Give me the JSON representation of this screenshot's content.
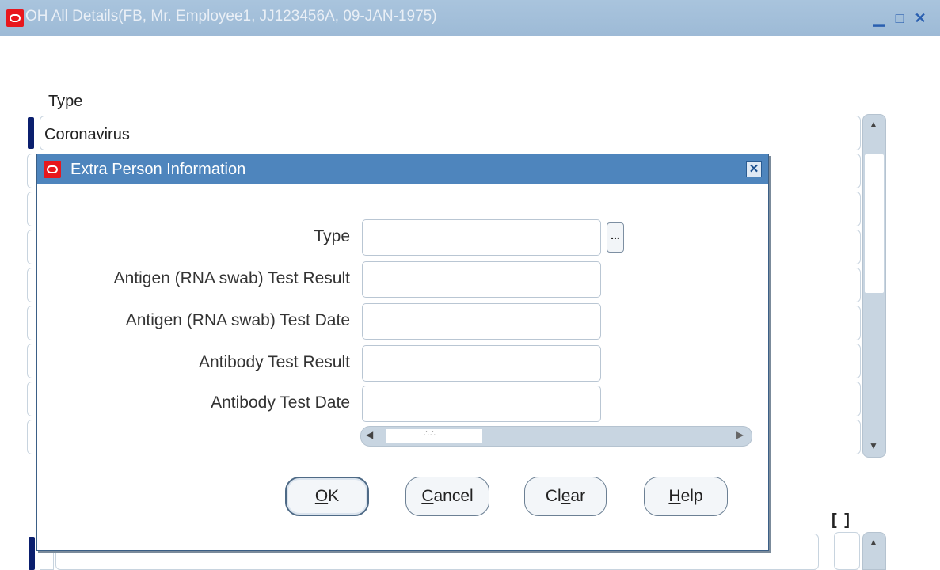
{
  "window": {
    "title": "OH All Details(FB, Mr. Employee1, JJ123456A, 09-JAN-1975)",
    "minimize_icon": "minimize-icon",
    "maximize_icon": "maximize-icon",
    "close_icon": "close-icon"
  },
  "form": {
    "type_header": "Type",
    "rows": [
      "Coronavirus",
      "",
      "",
      "",
      "",
      "",
      "",
      "",
      ""
    ],
    "bracket_label": "[ ]"
  },
  "dialog": {
    "title": "Extra Person Information",
    "fields": [
      {
        "label": "Type",
        "value": ""
      },
      {
        "label": "Antigen (RNA swab) Test Result",
        "value": ""
      },
      {
        "label": "Antigen (RNA swab) Test Date",
        "value": ""
      },
      {
        "label": "Antibody Test Result",
        "value": ""
      },
      {
        "label": "Antibody Test Date",
        "value": ""
      }
    ],
    "lov_button_label": "...",
    "buttons": {
      "ok_mnemonic": "O",
      "ok_rest": "K",
      "cancel_mnemonic": "C",
      "cancel_rest": "ancel",
      "clear_before": "Cl",
      "clear_mnemonic": "e",
      "clear_rest": "ar",
      "help_mnemonic": "H",
      "help_rest": "elp"
    }
  },
  "colors": {
    "titlebar": "#a9c4dd",
    "dialog_titlebar": "#4e85bd",
    "oracle_red": "#e8171d",
    "row_marker": "#0b1f6e"
  }
}
